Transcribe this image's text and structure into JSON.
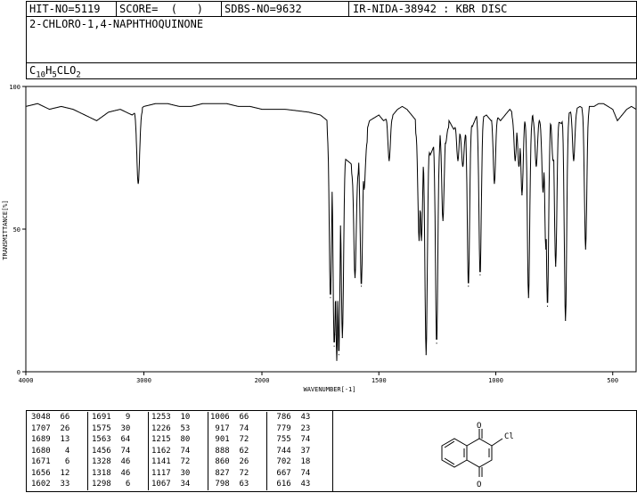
{
  "header": {
    "hit_no": "HIT-NO=5119",
    "score": "SCORE=  (   )",
    "sdbs_no": "SDBS-NO=9632",
    "ir_info": "IR-NIDA-38942 : KBR DISC"
  },
  "compound_name": "2-CHLORO-1,4-NAPHTHOQUINONE",
  "formula": {
    "c": "C",
    "c_n": "10",
    "h": "H",
    "h_n": "5",
    "rest": "CLO",
    "o_n": "2"
  },
  "chart_data": {
    "type": "line",
    "title": "",
    "xlabel": "WAVENUMBER[-1]",
    "ylabel": "TRANSMITTANCE[%]",
    "xlim": [
      4000,
      400
    ],
    "ylim": [
      0,
      100
    ],
    "x_ticks": [
      4000,
      3000,
      2000,
      1500,
      1000,
      500
    ],
    "y_ticks": [
      0,
      50,
      100
    ],
    "grid": false,
    "baseline": [
      [
        4000,
        93
      ],
      [
        3900,
        94
      ],
      [
        3800,
        92
      ],
      [
        3700,
        93
      ],
      [
        3600,
        92
      ],
      [
        3500,
        90
      ],
      [
        3400,
        88
      ],
      [
        3300,
        91
      ],
      [
        3200,
        92
      ],
      [
        3100,
        90
      ],
      [
        3000,
        93
      ],
      [
        2900,
        94
      ],
      [
        2800,
        94
      ],
      [
        2700,
        93
      ],
      [
        2600,
        93
      ],
      [
        2500,
        94
      ],
      [
        2400,
        94
      ],
      [
        2300,
        94
      ],
      [
        2200,
        93
      ],
      [
        2100,
        93
      ],
      [
        2000,
        92
      ],
      [
        1900,
        92
      ],
      [
        1800,
        91
      ],
      [
        1750,
        90
      ],
      [
        1720,
        88
      ],
      [
        1680,
        80
      ],
      [
        1650,
        75
      ],
      [
        1620,
        73
      ],
      [
        1600,
        70
      ],
      [
        1580,
        76
      ],
      [
        1560,
        82
      ],
      [
        1540,
        88
      ],
      [
        1500,
        90
      ],
      [
        1480,
        88
      ],
      [
        1460,
        89
      ],
      [
        1440,
        90
      ],
      [
        1420,
        92
      ],
      [
        1400,
        93
      ],
      [
        1380,
        92
      ],
      [
        1360,
        90
      ],
      [
        1340,
        88
      ],
      [
        1320,
        82
      ],
      [
        1300,
        80
      ],
      [
        1280,
        76
      ],
      [
        1260,
        80
      ],
      [
        1240,
        84
      ],
      [
        1220,
        85
      ],
      [
        1200,
        88
      ],
      [
        1180,
        85
      ],
      [
        1160,
        87
      ],
      [
        1140,
        84
      ],
      [
        1120,
        88
      ],
      [
        1100,
        86
      ],
      [
        1080,
        90
      ],
      [
        1060,
        89
      ],
      [
        1040,
        90
      ],
      [
        1020,
        88
      ],
      [
        1000,
        90
      ],
      [
        980,
        88
      ],
      [
        960,
        90
      ],
      [
        940,
        92
      ],
      [
        920,
        90
      ],
      [
        900,
        88
      ],
      [
        880,
        90
      ],
      [
        860,
        88
      ],
      [
        840,
        90
      ],
      [
        820,
        88
      ],
      [
        800,
        88
      ],
      [
        780,
        89
      ],
      [
        760,
        90
      ],
      [
        740,
        88
      ],
      [
        720,
        87
      ],
      [
        700,
        90
      ],
      [
        680,
        91
      ],
      [
        660,
        92
      ],
      [
        640,
        93
      ],
      [
        620,
        92
      ],
      [
        600,
        93
      ],
      [
        580,
        93
      ],
      [
        560,
        94
      ],
      [
        540,
        94
      ],
      [
        520,
        93
      ],
      [
        500,
        92
      ],
      [
        480,
        88
      ],
      [
        460,
        90
      ],
      [
        440,
        92
      ],
      [
        420,
        93
      ],
      [
        400,
        92
      ]
    ],
    "peaks": [
      [
        3048,
        66
      ],
      [
        1707,
        26
      ],
      [
        1689,
        13
      ],
      [
        1680,
        4
      ],
      [
        1671,
        6
      ],
      [
        1656,
        12
      ],
      [
        1602,
        33
      ],
      [
        1691,
        9
      ],
      [
        1575,
        30
      ],
      [
        1563,
        64
      ],
      [
        1456,
        74
      ],
      [
        1328,
        46
      ],
      [
        1318,
        46
      ],
      [
        1298,
        6
      ],
      [
        1253,
        10
      ],
      [
        1226,
        53
      ],
      [
        1215,
        80
      ],
      [
        1162,
        74
      ],
      [
        1141,
        72
      ],
      [
        1117,
        30
      ],
      [
        1067,
        34
      ],
      [
        1006,
        66
      ],
      [
        917,
        74
      ],
      [
        901,
        72
      ],
      [
        888,
        62
      ],
      [
        860,
        26
      ],
      [
        827,
        72
      ],
      [
        798,
        63
      ],
      [
        786,
        43
      ],
      [
        779,
        23
      ],
      [
        755,
        74
      ],
      [
        744,
        37
      ],
      [
        702,
        18
      ],
      [
        667,
        74
      ],
      [
        616,
        43
      ]
    ]
  },
  "peak_table": [
    [
      [
        "3048",
        "66"
      ],
      [
        "1707",
        "26"
      ],
      [
        "1689",
        "13"
      ],
      [
        "1680",
        "4"
      ],
      [
        "1671",
        "6"
      ],
      [
        "1656",
        "12"
      ],
      [
        "1602",
        "33"
      ]
    ],
    [
      [
        "1691",
        "9"
      ],
      [
        "1575",
        "30"
      ],
      [
        "1563",
        "64"
      ],
      [
        "1456",
        "74"
      ],
      [
        "1328",
        "46"
      ],
      [
        "1318",
        "46"
      ],
      [
        "1298",
        "6"
      ]
    ],
    [
      [
        "1253",
        "10"
      ],
      [
        "1226",
        "53"
      ],
      [
        "1215",
        "80"
      ],
      [
        "1162",
        "74"
      ],
      [
        "1141",
        "72"
      ],
      [
        "1117",
        "30"
      ],
      [
        "1067",
        "34"
      ]
    ],
    [
      [
        "1006",
        "66"
      ],
      [
        "917",
        "74"
      ],
      [
        "901",
        "72"
      ],
      [
        "888",
        "62"
      ],
      [
        "860",
        "26"
      ],
      [
        "827",
        "72"
      ],
      [
        "798",
        "63"
      ]
    ],
    [
      [
        "786",
        "43"
      ],
      [
        "779",
        "23"
      ],
      [
        "755",
        "74"
      ],
      [
        "744",
        "37"
      ],
      [
        "702",
        "18"
      ],
      [
        "667",
        "74"
      ],
      [
        "616",
        "43"
      ]
    ]
  ],
  "structure": {
    "atom_o_top": "O",
    "atom_o_bottom": "O",
    "atom_cl": "Cl"
  }
}
